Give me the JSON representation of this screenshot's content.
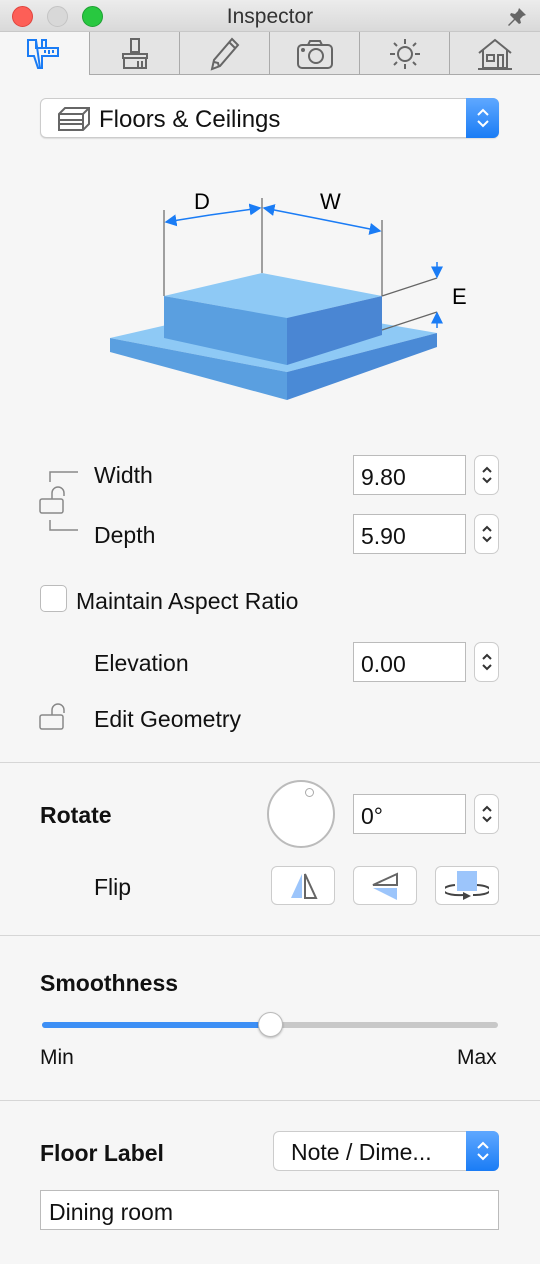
{
  "window": {
    "title": "Inspector",
    "colors": {
      "close": "#fd5f57",
      "minimize": "#d8d8d8",
      "zoom": "#28c840",
      "accent": "#1a7cf5"
    }
  },
  "tabs": [
    {
      "icon": "caliper-icon",
      "active": true
    },
    {
      "icon": "brush-icon"
    },
    {
      "icon": "pencil-icon"
    },
    {
      "icon": "camera-icon"
    },
    {
      "icon": "sun-icon"
    },
    {
      "icon": "house-icon"
    }
  ],
  "type_select": {
    "value": "Floors & Ceilings",
    "icon": "floor-box-icon"
  },
  "diagram": {
    "d": "D",
    "w": "W",
    "e": "E"
  },
  "dimensions": {
    "width_label": "Width",
    "width_value": "9.80",
    "depth_label": "Depth",
    "depth_value": "5.90",
    "maintain_aspect_label": "Maintain Aspect Ratio",
    "maintain_aspect_checked": false,
    "elevation_label": "Elevation",
    "elevation_value": "0.00",
    "edit_geometry_label": "Edit Geometry"
  },
  "rotate": {
    "label": "Rotate",
    "value": "0°",
    "flip_label": "Flip"
  },
  "smoothness": {
    "label": "Smoothness",
    "min": "Min",
    "max": "Max",
    "value_percent": 50
  },
  "floor_label": {
    "label": "Floor Label",
    "popup_value": "Note / Dime...",
    "text_value": "Dining room"
  }
}
